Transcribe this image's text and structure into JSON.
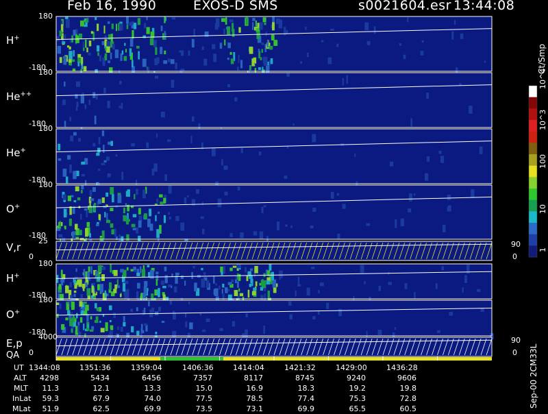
{
  "header": {
    "date": "Feb 16, 1990",
    "instrument": "EXOS-D SMS",
    "file": "s0021604.esr",
    "time": "13:44:08"
  },
  "colors": {
    "background": "#000000",
    "panel_bg": "#0a1a80",
    "frame": "#ffffff",
    "trace": "#ffffff",
    "param_trace": "#e8e020",
    "qa_bar": "#e8e020",
    "qa_good": "#30c030"
  },
  "colorbar": {
    "title": "Ct/Smp",
    "tick_labels": [
      "1",
      "10",
      "100",
      "10^3",
      "10^4"
    ],
    "colors": [
      "#101c78",
      "#1e3ea8",
      "#2c6cc8",
      "#1ab8c8",
      "#18a050",
      "#2ec82e",
      "#88d030",
      "#e8e020",
      "#a8a020",
      "#806010",
      "#d02010",
      "#e02020",
      "#b01010",
      "#800808",
      "#ffffff"
    ]
  },
  "chart_data": {
    "type": "heatmap",
    "x_tick_labels": [
      "1344:08",
      "1351:36",
      "1359:04",
      "1406:36",
      "1414:04",
      "1421:32",
      "1429:00",
      "1436:28"
    ],
    "panels": [
      {
        "id": "h-plus",
        "label": "H",
        "sup": "+",
        "ymax": "180",
        "ymin": "-180",
        "activity": [
          0.9,
          0.6,
          0.2,
          0.75,
          0.1,
          0.05,
          0.05,
          0.05
        ]
      },
      {
        "id": "he-plus-plus",
        "label": "He",
        "sup": "++",
        "ymax": "180",
        "ymin": "-180",
        "activity": [
          0.2,
          0.05,
          0.03,
          0.03,
          0.02,
          0.02,
          0.02,
          0.02
        ]
      },
      {
        "id": "he-plus",
        "label": "He",
        "sup": "+",
        "ymax": "180",
        "ymin": "-180",
        "activity": [
          0.35,
          0.1,
          0.05,
          0.04,
          0.03,
          0.03,
          0.03,
          0.03
        ]
      },
      {
        "id": "o-plus",
        "label": "O",
        "sup": "+",
        "ymax": "180",
        "ymin": "-180",
        "activity": [
          0.85,
          0.55,
          0.15,
          0.1,
          0.05,
          0.05,
          0.05,
          0.05
        ]
      },
      {
        "id": "v-r",
        "label": "V,r",
        "sup": "",
        "ymax": "25",
        "ymin": "0",
        "right_max": "90",
        "right_min": "0",
        "activity": []
      },
      {
        "id": "h-plus-2",
        "label": "H",
        "sup": "+",
        "ymax": "180",
        "ymin": "-180",
        "activity": [
          0.85,
          0.7,
          0.3,
          0.8,
          0.1,
          0.05,
          0.05,
          0.05
        ]
      },
      {
        "id": "o-plus-2",
        "label": "O",
        "sup": "+",
        "ymax": "180",
        "ymin": "-180",
        "activity": [
          0.7,
          0.3,
          0.15,
          0.05,
          0.05,
          0.03,
          0.03,
          0.03
        ]
      },
      {
        "id": "e-p",
        "label": "E,p",
        "sup": "",
        "ymax": "4000",
        "ymin": "0",
        "right_max": "90",
        "right_min": "0",
        "activity": []
      }
    ],
    "qa_label": "QA",
    "footer": [
      {
        "name": "UT",
        "values": [
          "1344:08",
          "1351:36",
          "1359:04",
          "1406:36",
          "1414:04",
          "1421:32",
          "1429:00",
          "1436:28"
        ]
      },
      {
        "name": "ALT",
        "values": [
          "4298",
          "5434",
          "6456",
          "7357",
          "8117",
          "8745",
          "9240",
          "9606"
        ]
      },
      {
        "name": "MLT",
        "values": [
          "11.3",
          "12.1",
          "13.3",
          "15.0",
          "16.9",
          "18.3",
          "19.2",
          "19.8"
        ]
      },
      {
        "name": "InLat",
        "values": [
          "59.3",
          "67.9",
          "74.0",
          "77.5",
          "78.5",
          "77.4",
          "75.3",
          "72.8"
        ]
      },
      {
        "name": "MLat",
        "values": [
          "51.9",
          "62.5",
          "69.9",
          "73.5",
          "73.1",
          "69.9",
          "65.5",
          "60.5"
        ]
      }
    ]
  },
  "side_stamp": "Sep-00  2CM33L"
}
